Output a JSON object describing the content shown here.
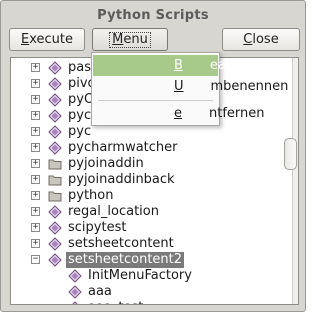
{
  "window": {
    "title": "Python Scripts"
  },
  "toolbar": {
    "execute_pre": "",
    "execute_u": "E",
    "execute_post": "xecute",
    "menu_pre": "",
    "menu_u": "M",
    "menu_post": "enu",
    "close_pre": "",
    "close_u": "C",
    "close_post": "lose"
  },
  "context_menu": {
    "items": [
      {
        "pre": "",
        "u": "B",
        "post": "earbeiten"
      },
      {
        "pre": "",
        "u": "U",
        "post": "mbenennen"
      },
      {
        "pre": "",
        "u": "e",
        "post": "ntfernen"
      }
    ]
  },
  "tree": {
    "rows": [
      {
        "label": "pas",
        "icon": "script-icon"
      },
      {
        "label": "pivo",
        "icon": "script-icon"
      },
      {
        "label": "pyO",
        "icon": "script-icon"
      },
      {
        "label": "pyc",
        "icon": "script-icon"
      },
      {
        "label": "pyc",
        "icon": "script-icon"
      },
      {
        "label": "pycharmwatcher",
        "icon": "script-icon"
      },
      {
        "label": "pyjoinaddin",
        "icon": "folder-icon"
      },
      {
        "label": "pyjoinaddinback",
        "icon": "folder-icon"
      },
      {
        "label": "python",
        "icon": "folder-icon"
      },
      {
        "label": "regal_location",
        "icon": "script-icon"
      },
      {
        "label": "scipytest",
        "icon": "script-icon"
      },
      {
        "label": "setsheetcontent",
        "icon": "script-icon"
      },
      {
        "label": "setsheetcontent2",
        "icon": "script-icon"
      },
      {
        "label": "InitMenuFactory",
        "icon": "script-icon"
      },
      {
        "label": "aaa",
        "icon": "script-icon"
      },
      {
        "label": "aaa_test",
        "icon": "script-icon"
      }
    ]
  },
  "colors": {
    "menu_highlight": "#a7c98a",
    "selection": "#7a7a7a"
  }
}
